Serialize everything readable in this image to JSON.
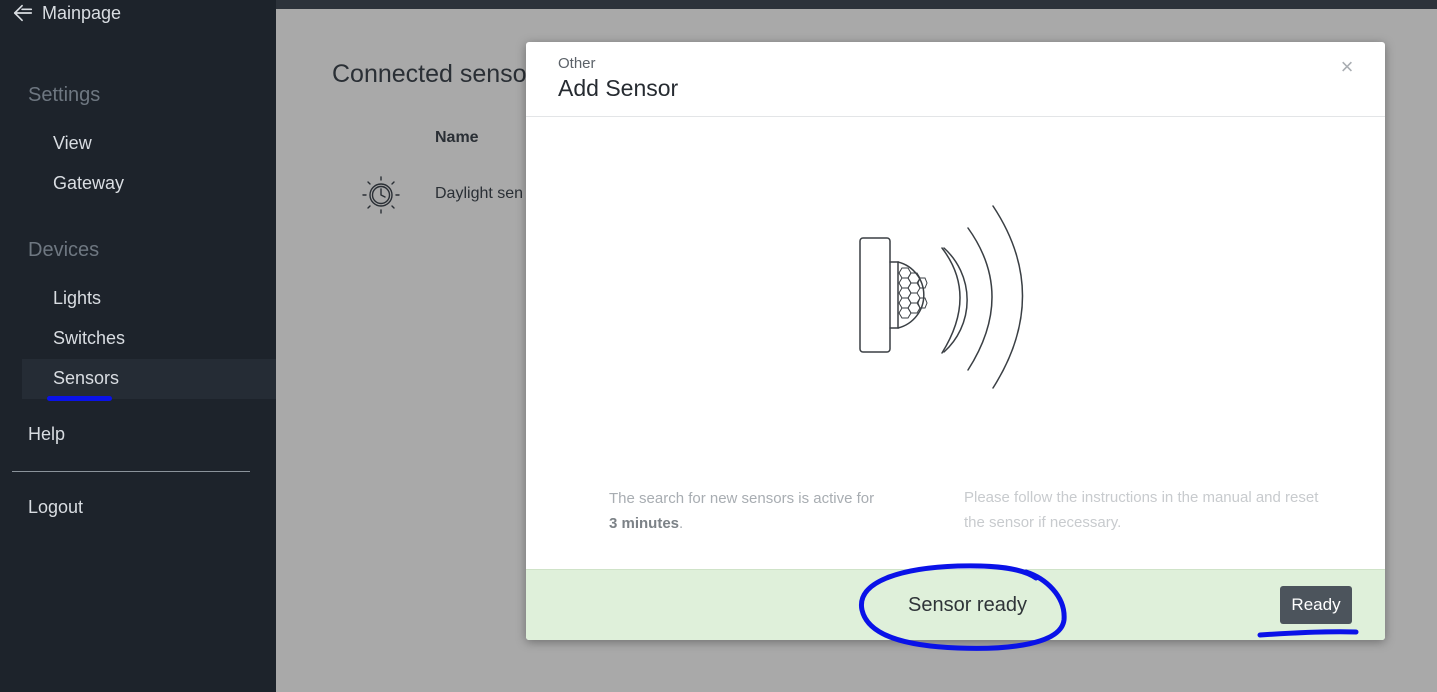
{
  "sidebar": {
    "back_label": "Mainpage",
    "sections": [
      {
        "heading": "Settings",
        "items": [
          "View",
          "Gateway"
        ]
      },
      {
        "heading": "Devices",
        "items": [
          "Lights",
          "Switches",
          "Sensors"
        ]
      }
    ],
    "active_item": "Sensors",
    "help_label": "Help",
    "logout_label": "Logout"
  },
  "main": {
    "title": "Connected senso",
    "columns": {
      "name": "Name"
    },
    "rows": [
      {
        "name": "Daylight sen",
        "icon": "daylight-clock-icon"
      }
    ]
  },
  "modal": {
    "subtitle": "Other",
    "title": "Add Sensor",
    "close_glyph": "×",
    "info_left_text": "The search for new sensors is active for",
    "info_left_duration": "3 minutes",
    "info_left_suffix": ".",
    "info_right": "Please follow the instructions in the manual and reset the sensor if necessary.",
    "status_text": "Sensor ready",
    "ready_button": "Ready",
    "footer_color": "#dff0da",
    "illustration_icon": "motion-sensor-signal-icon"
  },
  "colors": {
    "sidebar_bg": "#1d232b",
    "annotation_blue": "#0a12e8",
    "button_bg": "#4c545c"
  }
}
